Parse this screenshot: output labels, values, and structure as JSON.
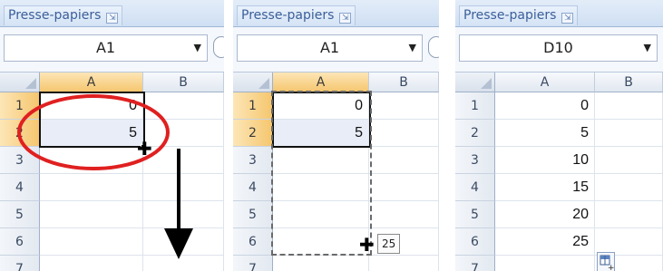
{
  "panels": [
    {
      "clipboard_label": "Presse-papiers",
      "name_box": "A1",
      "columns": [
        "A",
        "B"
      ],
      "rows": [
        "1",
        "2",
        "3",
        "4",
        "5",
        "6",
        "7"
      ],
      "cells": [
        "0",
        "5",
        "",
        "",
        "",
        "",
        ""
      ]
    },
    {
      "clipboard_label": "Presse-papiers",
      "name_box": "A1",
      "columns": [
        "A",
        "B"
      ],
      "rows": [
        "1",
        "2",
        "3",
        "4",
        "5",
        "6",
        "7"
      ],
      "cells": [
        "0",
        "5",
        "",
        "",
        "",
        "",
        ""
      ],
      "fill_tooltip": "25"
    },
    {
      "clipboard_label": "Presse-papiers",
      "name_box": "D10",
      "columns": [
        "A",
        "B"
      ],
      "rows": [
        "1",
        "2",
        "3",
        "4",
        "5",
        "6",
        "7"
      ],
      "cells": [
        "0",
        "5",
        "10",
        "15",
        "20",
        "25",
        ""
      ]
    }
  ],
  "colors": {
    "selected_header": "#f5c66f",
    "annotation_red": "#e02020",
    "ribbon_text": "#3b5f9a"
  },
  "icons": {
    "dialog_launcher": "dialog-launcher-icon",
    "fill_cursor": "fill-plus-cursor-icon",
    "arrow": "down-arrow-icon",
    "autofill_options": "autofill-options-icon"
  }
}
